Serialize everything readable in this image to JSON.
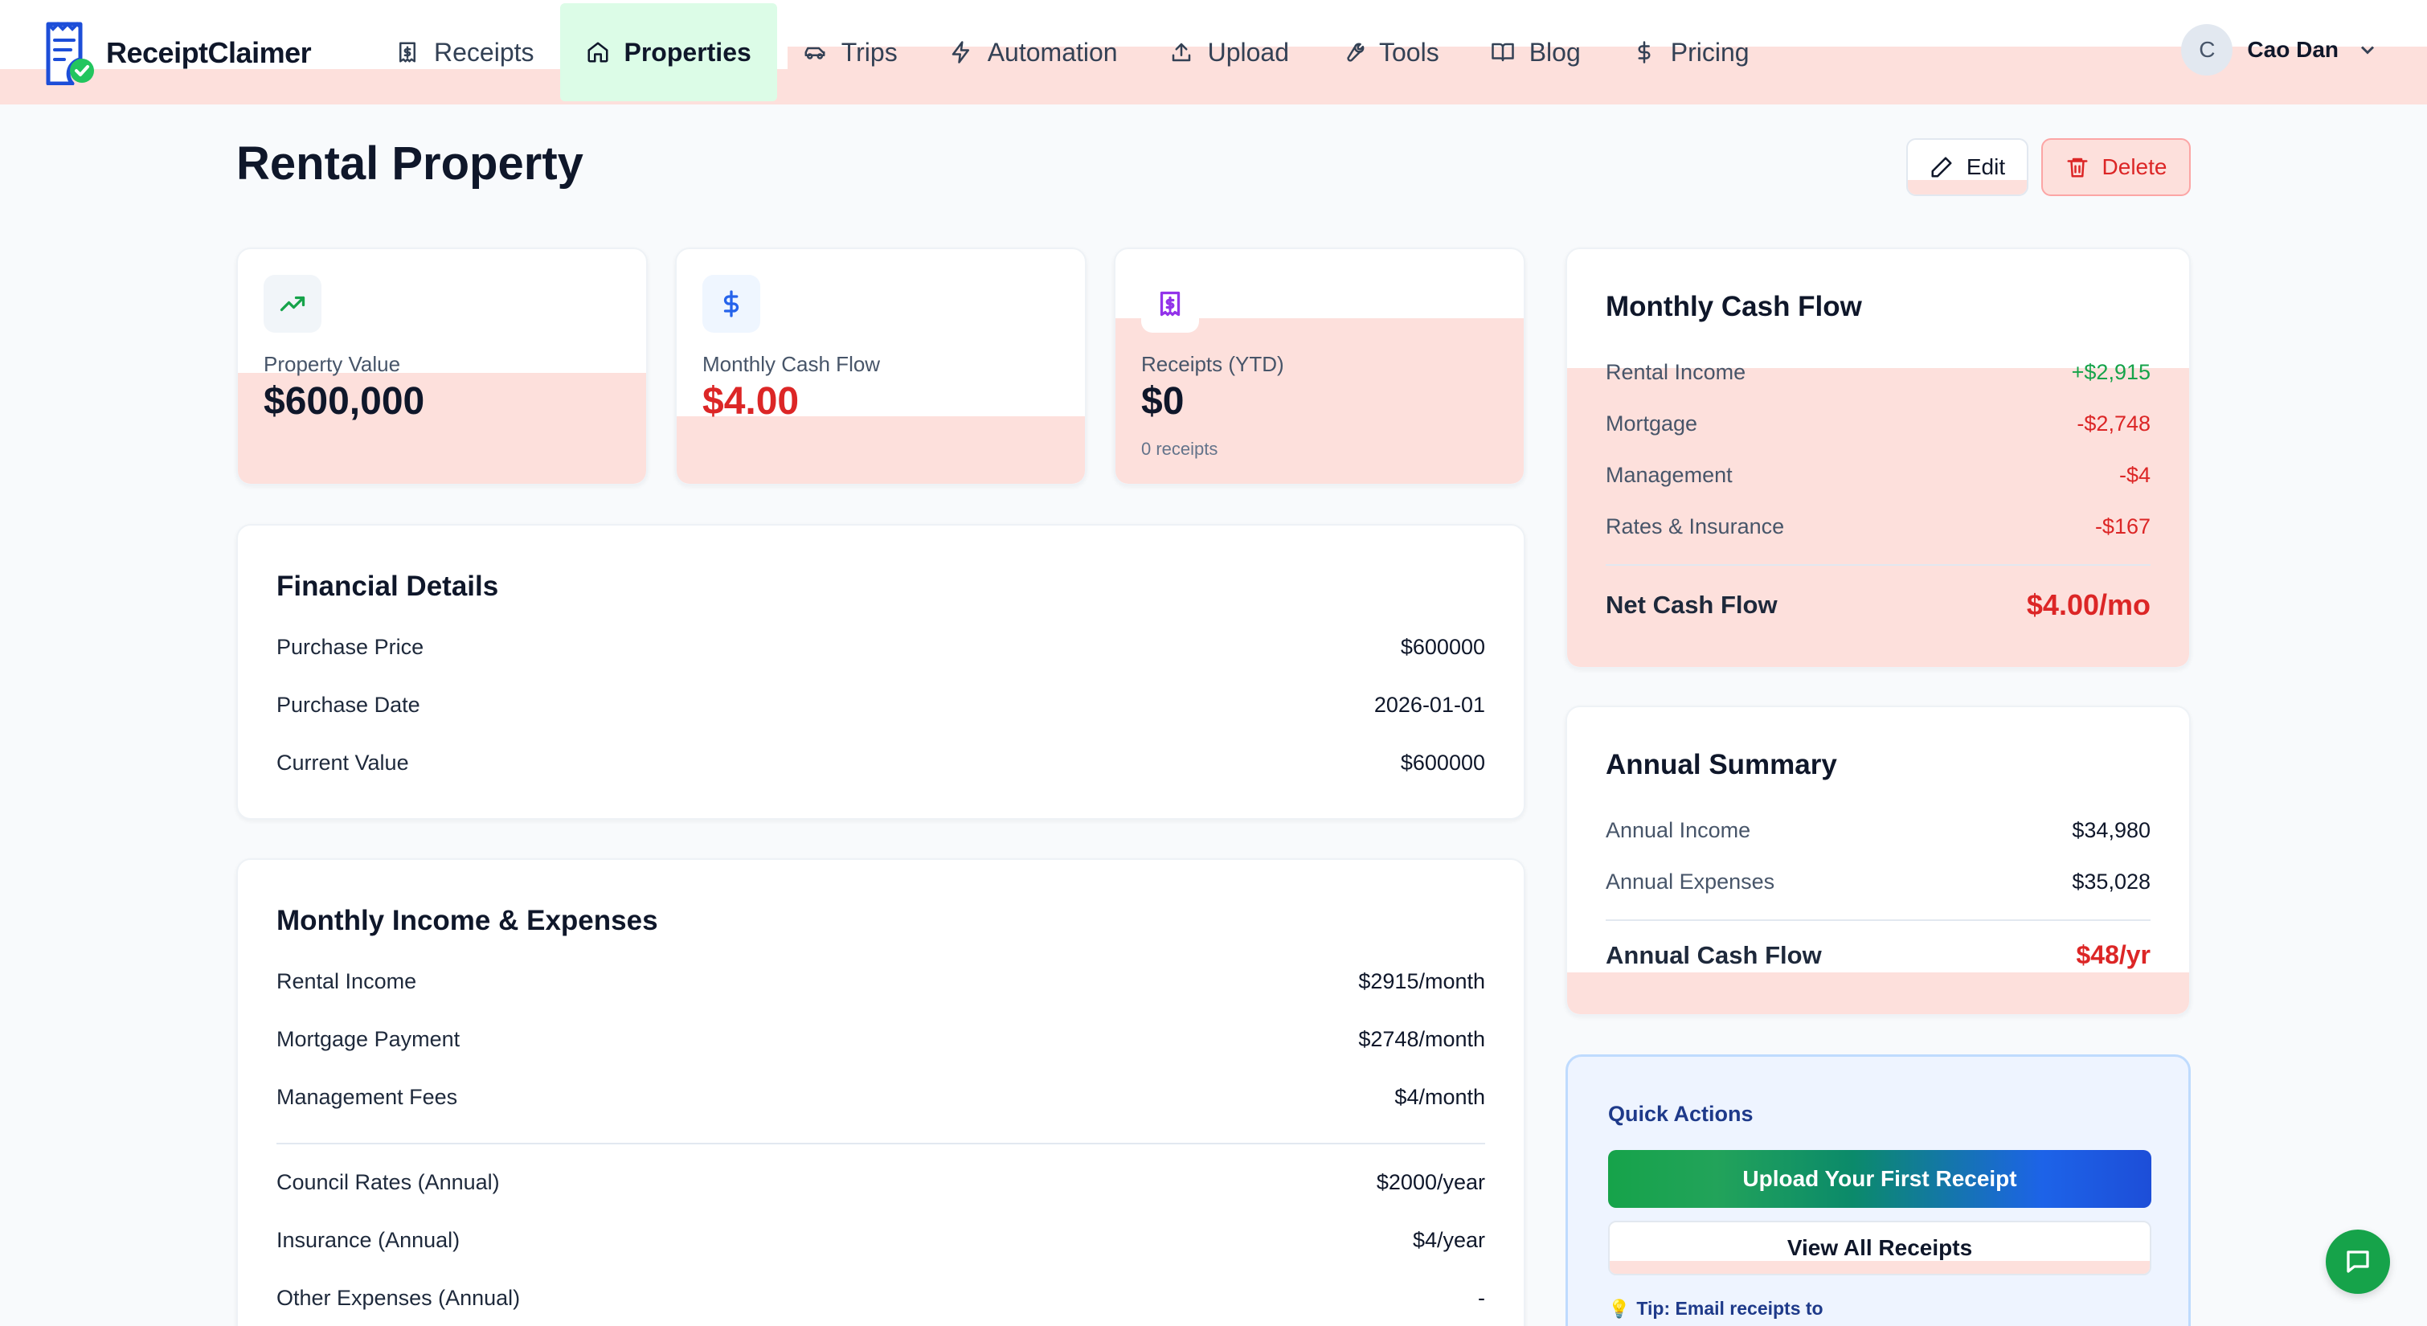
{
  "app": {
    "name": "ReceiptClaimer",
    "logo_icon": "receipt-check-icon"
  },
  "nav": {
    "items": [
      {
        "label": "Receipts",
        "icon": "receipt-icon"
      },
      {
        "label": "Properties",
        "icon": "home-icon",
        "active": true
      },
      {
        "label": "Trips",
        "icon": "car-icon"
      },
      {
        "label": "Automation",
        "icon": "lightning-icon"
      },
      {
        "label": "Upload",
        "icon": "upload-icon"
      },
      {
        "label": "Tools",
        "icon": "wrench-icon"
      },
      {
        "label": "Blog",
        "icon": "book-icon"
      },
      {
        "label": "Pricing",
        "icon": "dollar-icon"
      }
    ]
  },
  "user": {
    "initial": "C",
    "name": "Cao Dan"
  },
  "page": {
    "title": "Rental Property",
    "edit_label": "Edit",
    "delete_label": "Delete"
  },
  "stats": [
    {
      "label": "Property Value",
      "value": "$600,000",
      "icon": "trending-up-icon",
      "color": "#16a34a"
    },
    {
      "label": "Monthly Cash Flow",
      "value": "$4.00",
      "icon": "dollar-icon",
      "color": "#2563eb"
    },
    {
      "label": "Receipts (YTD)",
      "value": "$0",
      "sub": "0 receipts",
      "icon": "receipt-icon",
      "color": "#9333ea"
    }
  ],
  "financial_details": {
    "title": "Financial Details",
    "rows": [
      {
        "label": "Purchase Price",
        "value": "$600000"
      },
      {
        "label": "Purchase Date",
        "value": "2026-01-01"
      },
      {
        "label": "Current Value",
        "value": "$600000"
      }
    ]
  },
  "income_expenses": {
    "title": "Monthly Income & Expenses",
    "rows": [
      {
        "label": "Rental Income",
        "value": "$2915/month"
      },
      {
        "label": "Mortgage Payment",
        "value": "$2748/month"
      },
      {
        "label": "Management Fees",
        "value": "$4/month"
      },
      {
        "label": "Council Rates (Annual)",
        "value": "$2000/year"
      },
      {
        "label": "Insurance (Annual)",
        "value": "$4/year"
      },
      {
        "label": "Other Expenses (Annual)",
        "value": "-"
      }
    ]
  },
  "monthly_cash_flow": {
    "title": "Monthly Cash Flow",
    "rows": [
      {
        "label": "Rental Income",
        "value": "+$2,915"
      },
      {
        "label": "Mortgage",
        "value": "-$2,748"
      },
      {
        "label": "Management",
        "value": "-$4"
      },
      {
        "label": "Rates & Insurance",
        "value": "-$167"
      }
    ],
    "net_label": "Net Cash Flow",
    "net_value": "$4.00/mo"
  },
  "annual_summary": {
    "title": "Annual Summary",
    "rows": [
      {
        "label": "Annual Income",
        "value": "$34,980"
      },
      {
        "label": "Annual Expenses",
        "value": "$35,028"
      }
    ],
    "total_label": "Annual Cash Flow",
    "total_value": "$48/yr"
  },
  "quick_actions": {
    "title": "Quick Actions",
    "primary_label": "Upload Your First Receipt",
    "secondary_label": "View All Receipts",
    "tip": "Tip: Email receipts to"
  },
  "colors": {
    "accent_green": "#16a34a",
    "danger_red": "#dc2626",
    "active_nav_bg": "#dcfce7",
    "highlight_pink": "#fde0dc"
  }
}
